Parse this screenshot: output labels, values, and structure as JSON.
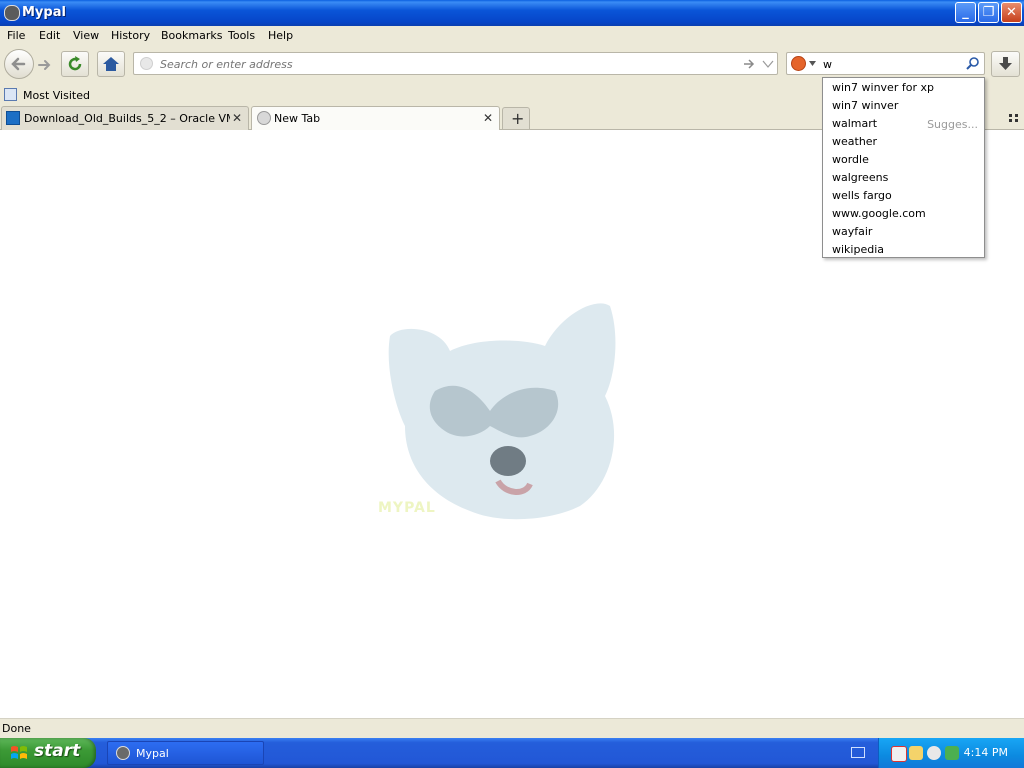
{
  "window": {
    "title": "Mypal"
  },
  "menu": [
    "File",
    "Edit",
    "View",
    "History",
    "Bookmarks",
    "Tools",
    "Help"
  ],
  "address_bar": {
    "placeholder": "Search or enter address",
    "value": ""
  },
  "search_bar": {
    "value": "w"
  },
  "bookmarks_toolbar": {
    "items": [
      "Most Visited"
    ]
  },
  "tabs": [
    {
      "label": "Download_Old_Builds_5_2 – Oracle VM Vi...",
      "active": false
    },
    {
      "label": "New Tab",
      "active": true
    }
  ],
  "search_suggestions": {
    "items": [
      "win7 winver for xp",
      "win7 winver",
      "walmart",
      "weather",
      "wordle",
      "walgreens",
      "wells fargo",
      "www.google.com",
      "wayfair",
      "wikipedia"
    ],
    "source_label": "Sugges..."
  },
  "page": {
    "logo_text": "MYPAL"
  },
  "status": {
    "text": "Done"
  },
  "taskbar": {
    "start_label": "start",
    "items": [
      {
        "label": "Mypal"
      }
    ],
    "clock": "4:14 PM"
  },
  "colors": {
    "titlebar": "#0a55d8",
    "chrome": "#ece9d8",
    "taskbar": "#245edb",
    "start_button": "#3c9a36",
    "tray": "#0c8ae0"
  }
}
